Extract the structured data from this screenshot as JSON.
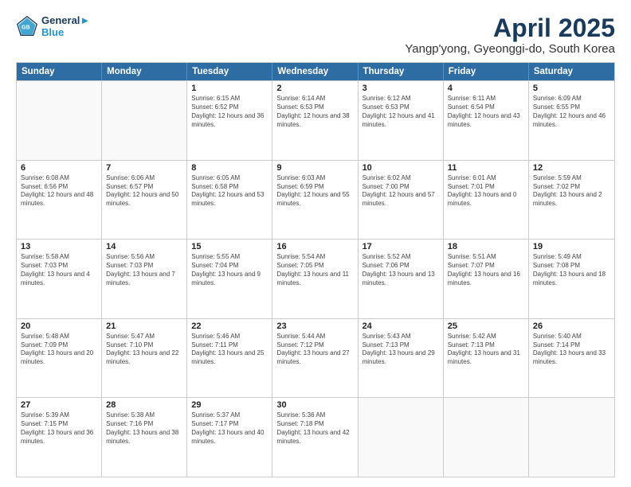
{
  "logo": {
    "line1": "General",
    "line2": "Blue"
  },
  "title": "April 2025",
  "location": "Yangp'yong, Gyeonggi-do, South Korea",
  "header_days": [
    "Sunday",
    "Monday",
    "Tuesday",
    "Wednesday",
    "Thursday",
    "Friday",
    "Saturday"
  ],
  "weeks": [
    [
      {
        "day": "",
        "sunrise": "",
        "sunset": "",
        "daylight": "",
        "empty": true
      },
      {
        "day": "",
        "sunrise": "",
        "sunset": "",
        "daylight": "",
        "empty": true
      },
      {
        "day": "1",
        "sunrise": "Sunrise: 6:15 AM",
        "sunset": "Sunset: 6:52 PM",
        "daylight": "Daylight: 12 hours and 36 minutes."
      },
      {
        "day": "2",
        "sunrise": "Sunrise: 6:14 AM",
        "sunset": "Sunset: 6:53 PM",
        "daylight": "Daylight: 12 hours and 38 minutes."
      },
      {
        "day": "3",
        "sunrise": "Sunrise: 6:12 AM",
        "sunset": "Sunset: 6:53 PM",
        "daylight": "Daylight: 12 hours and 41 minutes."
      },
      {
        "day": "4",
        "sunrise": "Sunrise: 6:11 AM",
        "sunset": "Sunset: 6:54 PM",
        "daylight": "Daylight: 12 hours and 43 minutes."
      },
      {
        "day": "5",
        "sunrise": "Sunrise: 6:09 AM",
        "sunset": "Sunset: 6:55 PM",
        "daylight": "Daylight: 12 hours and 46 minutes."
      }
    ],
    [
      {
        "day": "6",
        "sunrise": "Sunrise: 6:08 AM",
        "sunset": "Sunset: 6:56 PM",
        "daylight": "Daylight: 12 hours and 48 minutes."
      },
      {
        "day": "7",
        "sunrise": "Sunrise: 6:06 AM",
        "sunset": "Sunset: 6:57 PM",
        "daylight": "Daylight: 12 hours and 50 minutes."
      },
      {
        "day": "8",
        "sunrise": "Sunrise: 6:05 AM",
        "sunset": "Sunset: 6:58 PM",
        "daylight": "Daylight: 12 hours and 53 minutes."
      },
      {
        "day": "9",
        "sunrise": "Sunrise: 6:03 AM",
        "sunset": "Sunset: 6:59 PM",
        "daylight": "Daylight: 12 hours and 55 minutes."
      },
      {
        "day": "10",
        "sunrise": "Sunrise: 6:02 AM",
        "sunset": "Sunset: 7:00 PM",
        "daylight": "Daylight: 12 hours and 57 minutes."
      },
      {
        "day": "11",
        "sunrise": "Sunrise: 6:01 AM",
        "sunset": "Sunset: 7:01 PM",
        "daylight": "Daylight: 13 hours and 0 minutes."
      },
      {
        "day": "12",
        "sunrise": "Sunrise: 5:59 AM",
        "sunset": "Sunset: 7:02 PM",
        "daylight": "Daylight: 13 hours and 2 minutes."
      }
    ],
    [
      {
        "day": "13",
        "sunrise": "Sunrise: 5:58 AM",
        "sunset": "Sunset: 7:03 PM",
        "daylight": "Daylight: 13 hours and 4 minutes."
      },
      {
        "day": "14",
        "sunrise": "Sunrise: 5:56 AM",
        "sunset": "Sunset: 7:03 PM",
        "daylight": "Daylight: 13 hours and 7 minutes."
      },
      {
        "day": "15",
        "sunrise": "Sunrise: 5:55 AM",
        "sunset": "Sunset: 7:04 PM",
        "daylight": "Daylight: 13 hours and 9 minutes."
      },
      {
        "day": "16",
        "sunrise": "Sunrise: 5:54 AM",
        "sunset": "Sunset: 7:05 PM",
        "daylight": "Daylight: 13 hours and 11 minutes."
      },
      {
        "day": "17",
        "sunrise": "Sunrise: 5:52 AM",
        "sunset": "Sunset: 7:06 PM",
        "daylight": "Daylight: 13 hours and 13 minutes."
      },
      {
        "day": "18",
        "sunrise": "Sunrise: 5:51 AM",
        "sunset": "Sunset: 7:07 PM",
        "daylight": "Daylight: 13 hours and 16 minutes."
      },
      {
        "day": "19",
        "sunrise": "Sunrise: 5:49 AM",
        "sunset": "Sunset: 7:08 PM",
        "daylight": "Daylight: 13 hours and 18 minutes."
      }
    ],
    [
      {
        "day": "20",
        "sunrise": "Sunrise: 5:48 AM",
        "sunset": "Sunset: 7:09 PM",
        "daylight": "Daylight: 13 hours and 20 minutes."
      },
      {
        "day": "21",
        "sunrise": "Sunrise: 5:47 AM",
        "sunset": "Sunset: 7:10 PM",
        "daylight": "Daylight: 13 hours and 22 minutes."
      },
      {
        "day": "22",
        "sunrise": "Sunrise: 5:46 AM",
        "sunset": "Sunset: 7:11 PM",
        "daylight": "Daylight: 13 hours and 25 minutes."
      },
      {
        "day": "23",
        "sunrise": "Sunrise: 5:44 AM",
        "sunset": "Sunset: 7:12 PM",
        "daylight": "Daylight: 13 hours and 27 minutes."
      },
      {
        "day": "24",
        "sunrise": "Sunrise: 5:43 AM",
        "sunset": "Sunset: 7:13 PM",
        "daylight": "Daylight: 13 hours and 29 minutes."
      },
      {
        "day": "25",
        "sunrise": "Sunrise: 5:42 AM",
        "sunset": "Sunset: 7:13 PM",
        "daylight": "Daylight: 13 hours and 31 minutes."
      },
      {
        "day": "26",
        "sunrise": "Sunrise: 5:40 AM",
        "sunset": "Sunset: 7:14 PM",
        "daylight": "Daylight: 13 hours and 33 minutes."
      }
    ],
    [
      {
        "day": "27",
        "sunrise": "Sunrise: 5:39 AM",
        "sunset": "Sunset: 7:15 PM",
        "daylight": "Daylight: 13 hours and 36 minutes."
      },
      {
        "day": "28",
        "sunrise": "Sunrise: 5:38 AM",
        "sunset": "Sunset: 7:16 PM",
        "daylight": "Daylight: 13 hours and 38 minutes."
      },
      {
        "day": "29",
        "sunrise": "Sunrise: 5:37 AM",
        "sunset": "Sunset: 7:17 PM",
        "daylight": "Daylight: 13 hours and 40 minutes."
      },
      {
        "day": "30",
        "sunrise": "Sunrise: 5:36 AM",
        "sunset": "Sunset: 7:18 PM",
        "daylight": "Daylight: 13 hours and 42 minutes."
      },
      {
        "day": "",
        "sunrise": "",
        "sunset": "",
        "daylight": "",
        "empty": true
      },
      {
        "day": "",
        "sunrise": "",
        "sunset": "",
        "daylight": "",
        "empty": true
      },
      {
        "day": "",
        "sunrise": "",
        "sunset": "",
        "daylight": "",
        "empty": true
      }
    ]
  ]
}
